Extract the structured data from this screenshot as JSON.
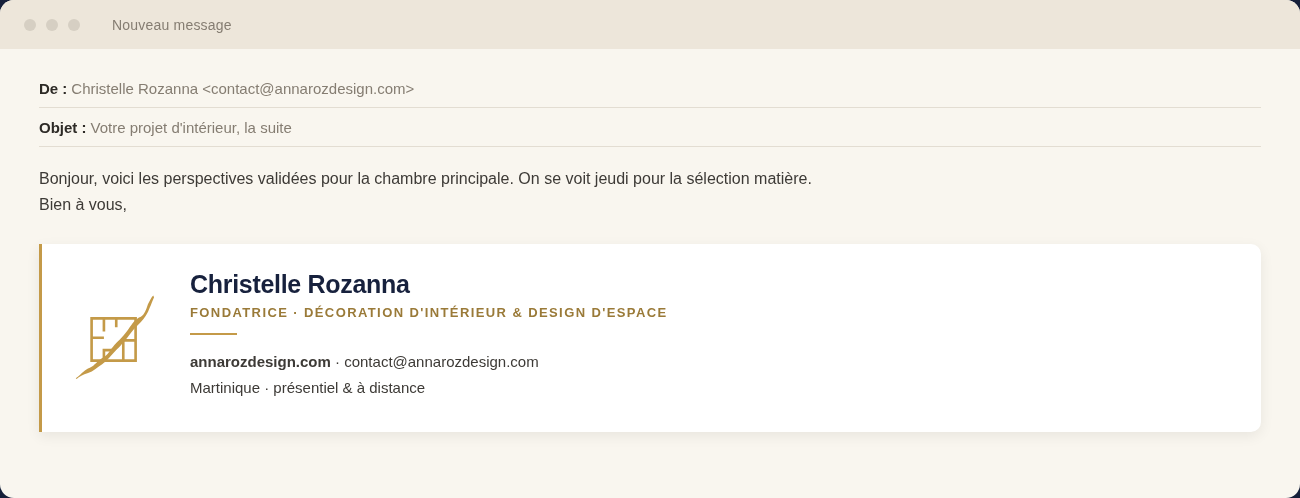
{
  "window": {
    "title": "Nouveau message"
  },
  "fields": [
    {
      "label": "De :",
      "value": "Christelle Rozanna <contact@annarozdesign.com>"
    },
    {
      "label": "Objet :",
      "value": "Votre projet d'intérieur, la suite"
    }
  ],
  "body": [
    "Bonjour, voici les perspectives validées pour la chambre principale. On se voit jeudi pour la sélection matière.",
    "Bien à vous,"
  ],
  "signature": {
    "name": "Christelle Rozanna",
    "role": "FONDATRICE · DÉCORATION D'INTÉRIEUR & DESIGN D'ESPACE",
    "contact": "**annarozdesign.com** · contact@annarozdesign.com",
    "location": "Martinique · présentiel & à distance"
  }
}
